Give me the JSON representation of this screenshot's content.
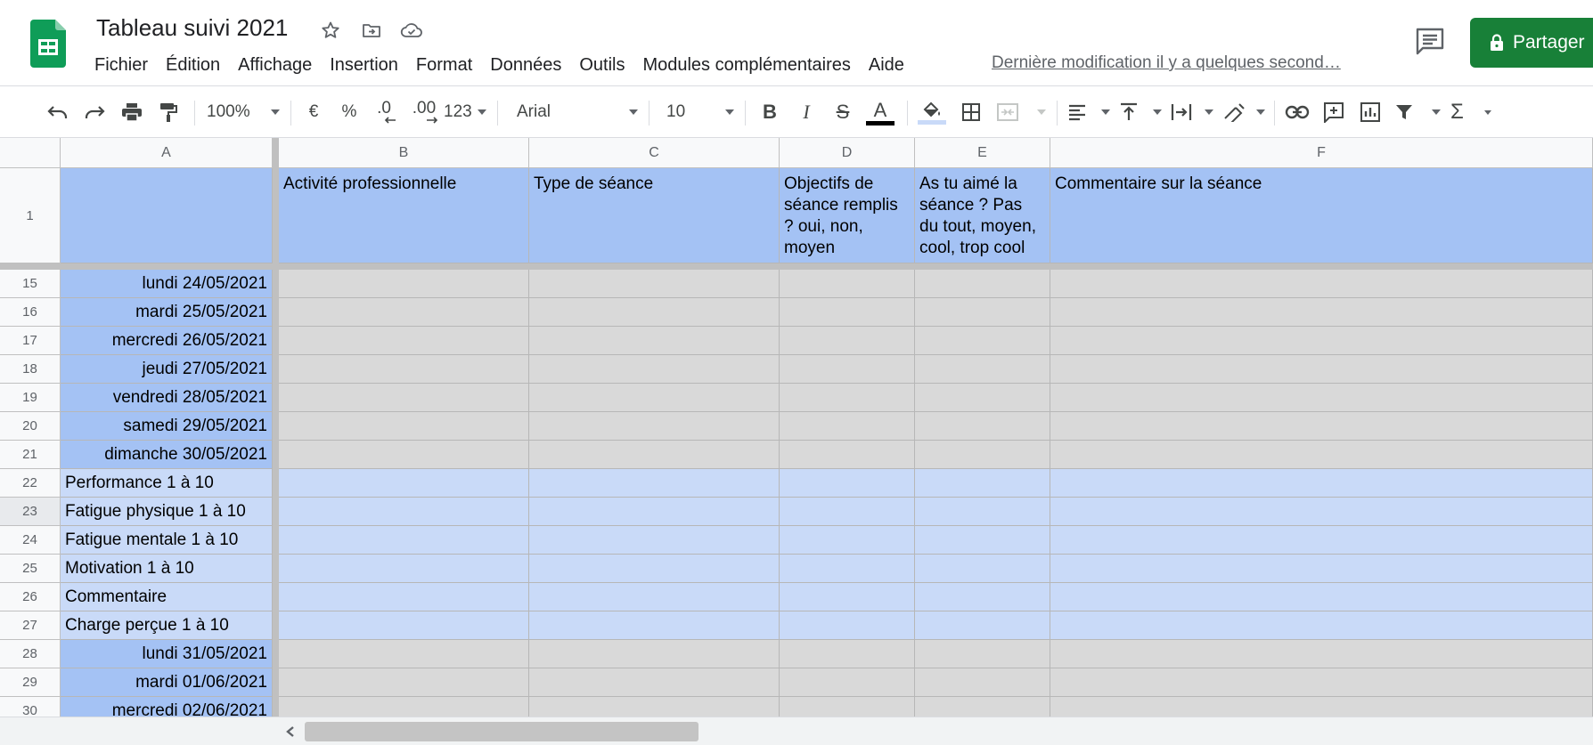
{
  "doc": {
    "title": "Tableau suivi 2021",
    "last_edit": "Dernière modification il y a quelques second…"
  },
  "menu": [
    "Fichier",
    "Édition",
    "Affichage",
    "Insertion",
    "Format",
    "Données",
    "Outils",
    "Modules complémentaires",
    "Aide"
  ],
  "share": {
    "label": "Partager"
  },
  "toolbar": {
    "zoom": "100%",
    "currency": "€",
    "percent": "%",
    "dec_decrease": ".0",
    "dec_increase": ".00",
    "number_format": "123",
    "font": "Arial",
    "font_size": "10",
    "bold": "B",
    "italic": "I",
    "strike": "S",
    "text_color_letter": "A"
  },
  "colors": {
    "header_blue": "#a4c2f4",
    "light_blue": "#c9daf8",
    "gray_cell": "#d9d9d9",
    "share_green": "#188038",
    "sheets_green": "#0f9d58"
  },
  "columns": [
    "A",
    "B",
    "C",
    "D",
    "E",
    "F"
  ],
  "header_row": {
    "number": "1",
    "cells": [
      "",
      "Activité professionnelle",
      "Type de séance",
      "Objectifs de séance remplis ? oui, non, moyen",
      "As tu aimé la séance ? Pas du tout, moyen, cool, trop cool",
      "Commentaire sur la séance"
    ]
  },
  "rows": [
    {
      "n": "15",
      "a": "lundi 24/05/2021"
    },
    {
      "n": "16",
      "a": "mardi 25/05/2021"
    },
    {
      "n": "17",
      "a": "mercredi 26/05/2021"
    },
    {
      "n": "18",
      "a": "jeudi 27/05/2021"
    },
    {
      "n": "19",
      "a": "vendredi 28/05/2021"
    },
    {
      "n": "20",
      "a": "samedi 29/05/2021"
    },
    {
      "n": "21",
      "a": "dimanche 30/05/2021"
    },
    {
      "n": "22",
      "a": "Performance 1 à 10"
    },
    {
      "n": "23",
      "a": "Fatigue physique 1 à 10"
    },
    {
      "n": "24",
      "a": "Fatigue mentale 1 à 10"
    },
    {
      "n": "25",
      "a": "Motivation 1 à 10"
    },
    {
      "n": "26",
      "a": "Commentaire"
    },
    {
      "n": "27",
      "a": "Charge perçue 1 à 10"
    },
    {
      "n": "28",
      "a": "lundi 31/05/2021"
    },
    {
      "n": "29",
      "a": "mardi 01/06/2021"
    },
    {
      "n": "30",
      "a": "mercredi 02/06/2021"
    }
  ]
}
